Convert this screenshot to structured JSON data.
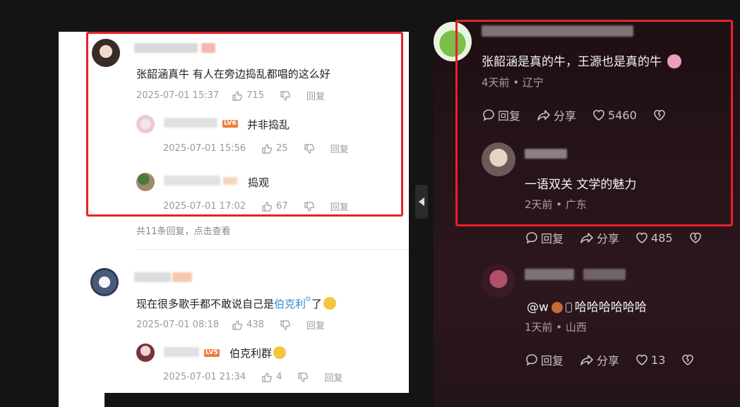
{
  "left": {
    "comments": [
      {
        "text": "张韶涵真牛 有人在旁边捣乱都唱的这么好",
        "date": "2025-07-01 15:37",
        "likes": "715",
        "reply_label": "回复"
      },
      {
        "text_before_link": "现在很多歌手都不敢说自己是",
        "link_text": "伯克利",
        "text_after_link": "了",
        "date": "2025-07-01 08:18",
        "likes": "438",
        "reply_label": "回复"
      }
    ],
    "replies": [
      {
        "badge": "LV6",
        "text": "并非捣乱",
        "date": "2025-07-01 15:56",
        "likes": "25",
        "reply_label": "回复"
      },
      {
        "text": "捣观",
        "date": "2025-07-01 17:02",
        "likes": "67",
        "reply_label": "回复"
      },
      {
        "badge": "LV5",
        "text": "伯克利群",
        "date": "2025-07-01 21:34",
        "likes": "4",
        "reply_label": "回复"
      }
    ],
    "more_replies": "共11条回复，点击查看"
  },
  "right": {
    "comments": [
      {
        "text": "张韶涵是真的牛，王源也是真的牛",
        "meta": "4天前 • 辽宁",
        "reply_label": "回复",
        "share_label": "分享",
        "likes": "5460"
      },
      {
        "text": "一语双关 文学的魅力",
        "meta": "2天前 • 广东",
        "reply_label": "回复",
        "share_label": "分享",
        "likes": "485"
      },
      {
        "mention": "@w",
        "text": "哈哈哈哈哈哈",
        "meta": "1天前 • 山西",
        "reply_label": "回复",
        "share_label": "分享",
        "likes": "13"
      }
    ]
  },
  "colors": {
    "highlight_border": "#e8202a",
    "link": "#2d8bd8",
    "level_badge": "#f07b3e"
  }
}
